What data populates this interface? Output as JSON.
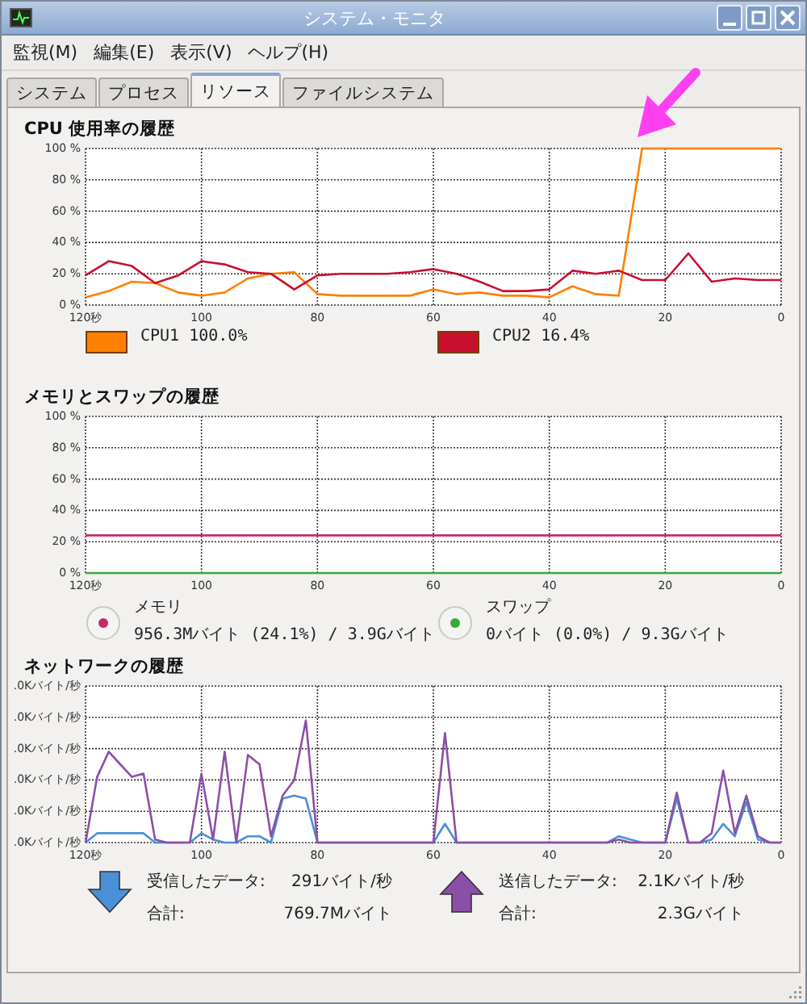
{
  "window": {
    "title": "システム・モニタ"
  },
  "menu": [
    "監視(M)",
    "編集(E)",
    "表示(V)",
    "ヘルプ(H)"
  ],
  "tabs": [
    {
      "label": "システム",
      "selected": false
    },
    {
      "label": "プロセス",
      "selected": false
    },
    {
      "label": "リソース",
      "selected": true
    },
    {
      "label": "ファイルシステム",
      "selected": false
    }
  ],
  "sections": [
    {
      "kind": "cpu",
      "title": "CPU 使用率の履歴",
      "chart_data": {
        "type": "line",
        "grid": true,
        "x": [
          120,
          116,
          112,
          108,
          104,
          100,
          96,
          92,
          88,
          84,
          80,
          76,
          72,
          68,
          64,
          60,
          56,
          52,
          48,
          44,
          40,
          36,
          32,
          28,
          24,
          20,
          16,
          12,
          8,
          4,
          0
        ],
        "series": [
          {
            "name": "CPU1",
            "color": "#ff7f00",
            "values": [
              5,
              9,
              15,
              14,
              8,
              6,
              8,
              17,
              20,
              21,
              7,
              6,
              6,
              6,
              6,
              10,
              7,
              8,
              6,
              6,
              5,
              12,
              7,
              6,
              100,
              100,
              100,
              100,
              100,
              100,
              100
            ]
          },
          {
            "name": "CPU2",
            "color": "#c8102e",
            "values": [
              19,
              28,
              25,
              14,
              19,
              28,
              26,
              21,
              20,
              10,
              19,
              20,
              20,
              20,
              21,
              23,
              20,
              15,
              9,
              9,
              10,
              22,
              20,
              22,
              16,
              16,
              33,
              15,
              17,
              16,
              16
            ]
          }
        ],
        "xlim": [
          120,
          0
        ],
        "ylim": [
          0,
          100
        ],
        "xticks": [
          {
            "value": 120,
            "label": "120秒"
          },
          {
            "value": 100,
            "label": "100"
          },
          {
            "value": 80,
            "label": "80"
          },
          {
            "value": 60,
            "label": "60"
          },
          {
            "value": 40,
            "label": "40"
          },
          {
            "value": 20,
            "label": "20"
          },
          {
            "value": 0,
            "label": "0"
          }
        ],
        "yticks": [
          {
            "value": 0,
            "label": "0 %"
          },
          {
            "value": 20,
            "label": "20 %"
          },
          {
            "value": 40,
            "label": "40 %"
          },
          {
            "value": 60,
            "label": "60 %"
          },
          {
            "value": 80,
            "label": "80 %"
          },
          {
            "value": 100,
            "label": "100 %"
          }
        ]
      },
      "legend": [
        {
          "reading": "100.0%"
        },
        {
          "reading": "16.4%"
        }
      ]
    },
    {
      "kind": "memory",
      "title": "メモリとスワップの履歴",
      "chart_data": {
        "type": "line",
        "grid": true,
        "x": [
          120,
          0
        ],
        "series": [
          {
            "name": "メモリ",
            "color": "#c8286a",
            "values": [
              24,
              24
            ]
          },
          {
            "name": "スワップ",
            "color": "#3aa83a",
            "values": [
              0,
              0
            ]
          }
        ],
        "xlim": [
          120,
          0
        ],
        "ylim": [
          0,
          100
        ],
        "xticks": [
          {
            "value": 120,
            "label": "120秒"
          },
          {
            "value": 100,
            "label": "100"
          },
          {
            "value": 80,
            "label": "80"
          },
          {
            "value": 60,
            "label": "60"
          },
          {
            "value": 40,
            "label": "40"
          },
          {
            "value": 20,
            "label": "20"
          },
          {
            "value": 0,
            "label": "0"
          }
        ],
        "yticks": [
          {
            "value": 0,
            "label": "0 %"
          },
          {
            "value": 20,
            "label": "20 %"
          },
          {
            "value": 40,
            "label": "40 %"
          },
          {
            "value": 60,
            "label": "60 %"
          },
          {
            "value": 80,
            "label": "80 %"
          },
          {
            "value": 100,
            "label": "100 %"
          }
        ]
      },
      "legend": [
        {
          "detail": "956.3Mバイト (24.1%) / 3.9Gバイト"
        },
        {
          "detail": "0バイト (0.0%) / 9.3Gバイト"
        }
      ]
    },
    {
      "kind": "network",
      "title": "ネットワークの履歴",
      "chart_data": {
        "type": "line",
        "grid": true,
        "x": [
          120,
          118,
          116,
          114,
          112,
          110,
          108,
          106,
          104,
          102,
          100,
          98,
          96,
          94,
          92,
          90,
          88,
          86,
          84,
          82,
          80,
          78,
          76,
          74,
          72,
          70,
          68,
          66,
          64,
          62,
          60,
          58,
          56,
          54,
          52,
          50,
          48,
          46,
          44,
          42,
          40,
          38,
          36,
          34,
          32,
          30,
          28,
          26,
          24,
          22,
          20,
          18,
          16,
          14,
          12,
          10,
          8,
          6,
          4,
          2,
          0
        ],
        "series": [
          {
            "color": "#4a90d9",
            "values": [
              0,
              0.3,
              0.3,
              0.3,
              0.3,
              0.3,
              0,
              0,
              0,
              0,
              0.3,
              0.1,
              0,
              0,
              0.2,
              0.2,
              0,
              1.4,
              1.5,
              1.4,
              0,
              0,
              0,
              0,
              0,
              0,
              0,
              0,
              0,
              0,
              0,
              0.6,
              0,
              0,
              0,
              0,
              0,
              0,
              0,
              0,
              0,
              0,
              0,
              0,
              0,
              0,
              0.2,
              0.1,
              0,
              0,
              0,
              1.4,
              0,
              0,
              0.1,
              0.6,
              0.2,
              1.3,
              0.1,
              0,
              0
            ]
          },
          {
            "color": "#8b4fa8",
            "values": [
              0,
              2.1,
              2.9,
              2.5,
              2.1,
              2.2,
              0.1,
              0,
              0,
              0,
              2.2,
              0.1,
              2.9,
              0,
              2.8,
              2.5,
              0.2,
              1.5,
              2.0,
              3.9,
              0,
              0,
              0,
              0,
              0,
              0,
              0,
              0,
              0,
              0,
              0,
              3.5,
              0,
              0,
              0,
              0,
              0,
              0,
              0,
              0,
              0,
              0,
              0,
              0,
              0,
              0,
              0.1,
              0,
              0,
              0,
              0,
              1.6,
              0,
              0,
              0.3,
              2.3,
              0.3,
              1.5,
              0.2,
              0,
              0
            ]
          }
        ],
        "xlim": [
          120,
          0
        ],
        "ylim": [
          0,
          5
        ],
        "xticks": [
          {
            "value": 120,
            "label": "120秒"
          },
          {
            "value": 100,
            "label": "100"
          },
          {
            "value": 80,
            "label": "80"
          },
          {
            "value": 60,
            "label": "60"
          },
          {
            "value": 40,
            "label": "40"
          },
          {
            "value": 20,
            "label": "20"
          },
          {
            "value": 0,
            "label": "0"
          }
        ],
        "yticks": [
          {
            "value": 0,
            "label": ".0Kバイト/秒"
          },
          {
            "value": 1,
            "label": ".0Kバイト/秒"
          },
          {
            "value": 2,
            "label": ".0Kバイト/秒"
          },
          {
            "value": 3,
            "label": ".0Kバイト/秒"
          },
          {
            "value": 4,
            "label": ".0Kバイト/秒"
          },
          {
            "value": 5,
            "label": ".0Kバイト/秒"
          }
        ]
      },
      "legend": [
        {
          "kind": "down",
          "label": "受信したデータ:",
          "rate": "291バイト/秒",
          "total_label": "合計:",
          "total": "769.7Mバイト"
        },
        {
          "kind": "up",
          "label": "送信したデータ:",
          "rate": "2.1Kバイト/秒",
          "total_label": "合計:",
          "total": "2.3Gバイト"
        }
      ]
    }
  ]
}
